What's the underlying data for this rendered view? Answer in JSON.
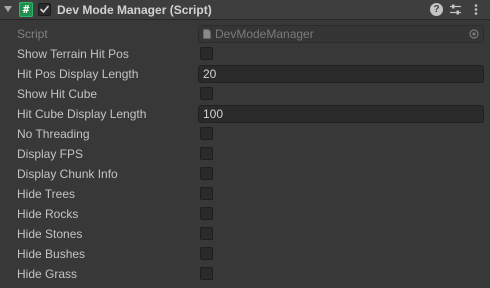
{
  "component": {
    "title": "Dev Mode Manager (Script)",
    "script_icon_glyph": "#",
    "enabled": true,
    "help_glyph": "?"
  },
  "fields": [
    {
      "label": "Script",
      "type": "object",
      "value": "DevModeManager",
      "disabled": true
    },
    {
      "label": "Show Terrain Hit Pos",
      "type": "checkbox",
      "checked": false
    },
    {
      "label": "Hit Pos Display Length",
      "type": "text",
      "value": "20"
    },
    {
      "label": "Show Hit Cube",
      "type": "checkbox",
      "checked": false
    },
    {
      "label": "Hit Cube Display Length",
      "type": "text",
      "value": "100"
    },
    {
      "label": "No Threading",
      "type": "checkbox",
      "checked": false
    },
    {
      "label": "Display FPS",
      "type": "checkbox",
      "checked": false
    },
    {
      "label": "Display Chunk Info",
      "type": "checkbox",
      "checked": false
    },
    {
      "label": "Hide Trees",
      "type": "checkbox",
      "checked": false
    },
    {
      "label": "Hide Rocks",
      "type": "checkbox",
      "checked": false
    },
    {
      "label": "Hide Stones",
      "type": "checkbox",
      "checked": false
    },
    {
      "label": "Hide Bushes",
      "type": "checkbox",
      "checked": false
    },
    {
      "label": "Hide Grass",
      "type": "checkbox",
      "checked": false
    }
  ],
  "icons": {
    "foldout": "chevron-down-icon",
    "script": "csharp-script-icon",
    "help": "help-icon",
    "presets": "presets-icon",
    "menu": "kebab-menu-icon",
    "file": "script-file-icon",
    "picker": "object-picker-icon"
  },
  "colors": {
    "background": "#383838",
    "header": "#3e3e3e",
    "field_bg": "#2a2a2a",
    "label": "#c4c4c4",
    "script_icon": "#1f8f4f"
  }
}
